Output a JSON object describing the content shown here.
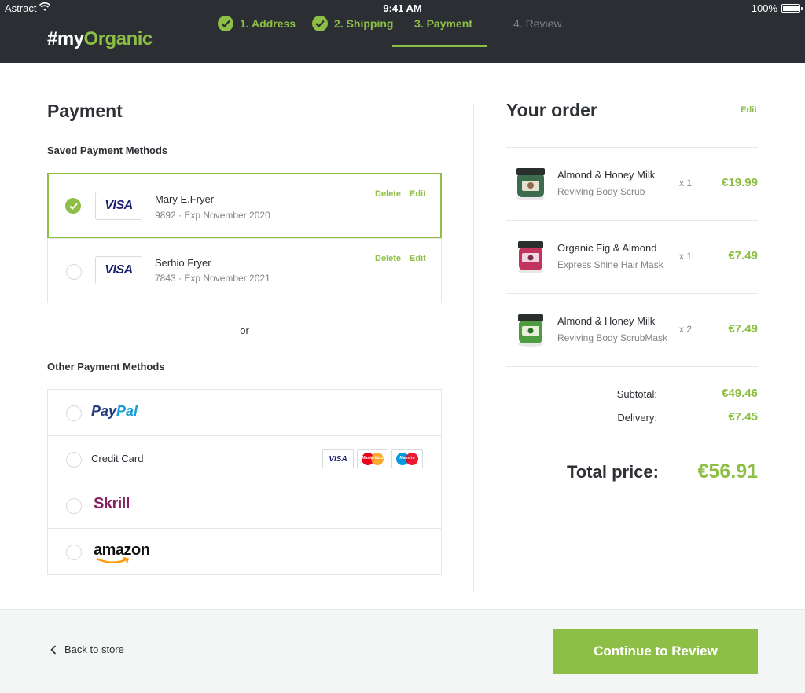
{
  "status_bar": {
    "carrier": "Astract",
    "time": "9:41 AM",
    "battery": "100%"
  },
  "header": {
    "logo_prefix": "#my",
    "logo_accent": "Organic",
    "steps": [
      {
        "label": "1. Address",
        "state": "done"
      },
      {
        "label": "2. Shipping",
        "state": "done"
      },
      {
        "label": "3. Payment",
        "state": "active"
      },
      {
        "label": "4. Review",
        "state": "inactive"
      }
    ]
  },
  "payment": {
    "title": "Payment",
    "saved_heading": "Saved Payment Methods",
    "saved_cards": [
      {
        "brand": "VISA",
        "name": "Mary E.Fryer",
        "detail": "9892 · Exp November 2020",
        "selected": true,
        "delete_label": "Delete",
        "edit_label": "Edit"
      },
      {
        "brand": "VISA",
        "name": "Serhio Fryer",
        "detail": "7843 · Exp November 2021",
        "selected": false,
        "delete_label": "Delete",
        "edit_label": "Edit"
      }
    ],
    "or_label": "or",
    "other_heading": "Other Payment Methods",
    "other_methods": [
      {
        "id": "paypal",
        "label_part1": "Pay",
        "label_part2": "Pal"
      },
      {
        "id": "credit-card",
        "label": "Credit Card",
        "logos": [
          "VISA",
          "MasterCard",
          "Maestro"
        ]
      },
      {
        "id": "skrill",
        "label": "Skrill"
      },
      {
        "id": "amazon",
        "label": "amazon"
      }
    ]
  },
  "order": {
    "title": "Your order",
    "edit_label": "Edit",
    "items": [
      {
        "name": "Almond & Honey Milk",
        "desc": "Reviving Body Scrub",
        "qty": "x 1",
        "price": "€19.99",
        "jar_lid": "#2a2e2c",
        "jar_body": "#3d6b4e",
        "jar_label": "#e6e0cf"
      },
      {
        "name": "Organic Fig & Almond",
        "desc": "Express Shine Hair Mask",
        "qty": "x 1",
        "price": "€7.49",
        "jar_lid": "#2a2e2c",
        "jar_body": "#c2335e",
        "jar_label": "#f2d7e1"
      },
      {
        "name": "Almond & Honey Milk",
        "desc": "Reviving Body ScrubMask",
        "qty": "x 2",
        "price": "€7.49",
        "jar_lid": "#2a2e2c",
        "jar_body": "#4f9b3f",
        "jar_label": "#e8f0d9"
      }
    ],
    "subtotal_label": "Subtotal:",
    "subtotal_value": "€49.46",
    "delivery_label": "Delivery:",
    "delivery_value": "€7.45",
    "total_label": "Total price:",
    "total_value": "€56.91"
  },
  "footer": {
    "back_label": "Back to store",
    "continue_label": "Continue to Review"
  },
  "colors": {
    "accent": "#8dbe45",
    "header_bg": "#2b2e33",
    "text": "#2d3035",
    "muted": "#7f8388"
  }
}
